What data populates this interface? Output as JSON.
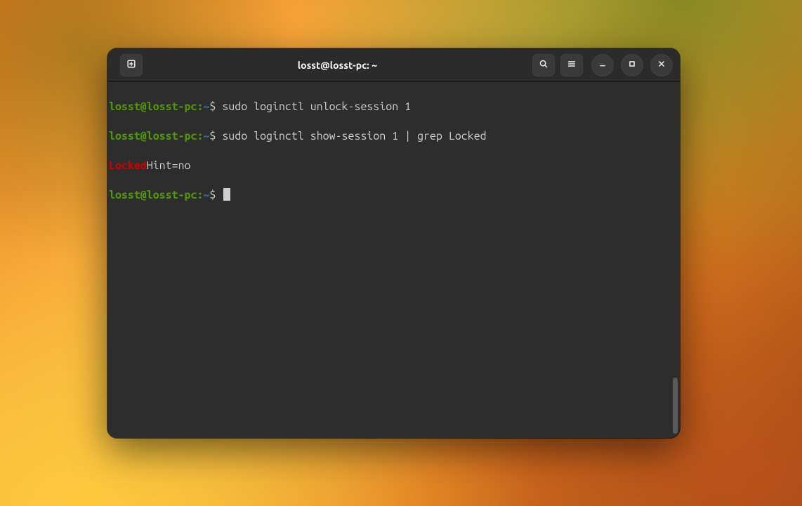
{
  "window": {
    "title": "losst@losst-pc: ~"
  },
  "prompt": {
    "userhost": "losst@losst-pc",
    "colon": ":",
    "path": "~",
    "symbol": "$"
  },
  "lines": {
    "l1_cmd": " sudo loginctl unlock-session 1",
    "l2_cmd": " sudo loginctl show-session 1 | grep Locked",
    "l3_match": "Locked",
    "l3_rest": "Hint=no",
    "l4_cmd": " "
  }
}
